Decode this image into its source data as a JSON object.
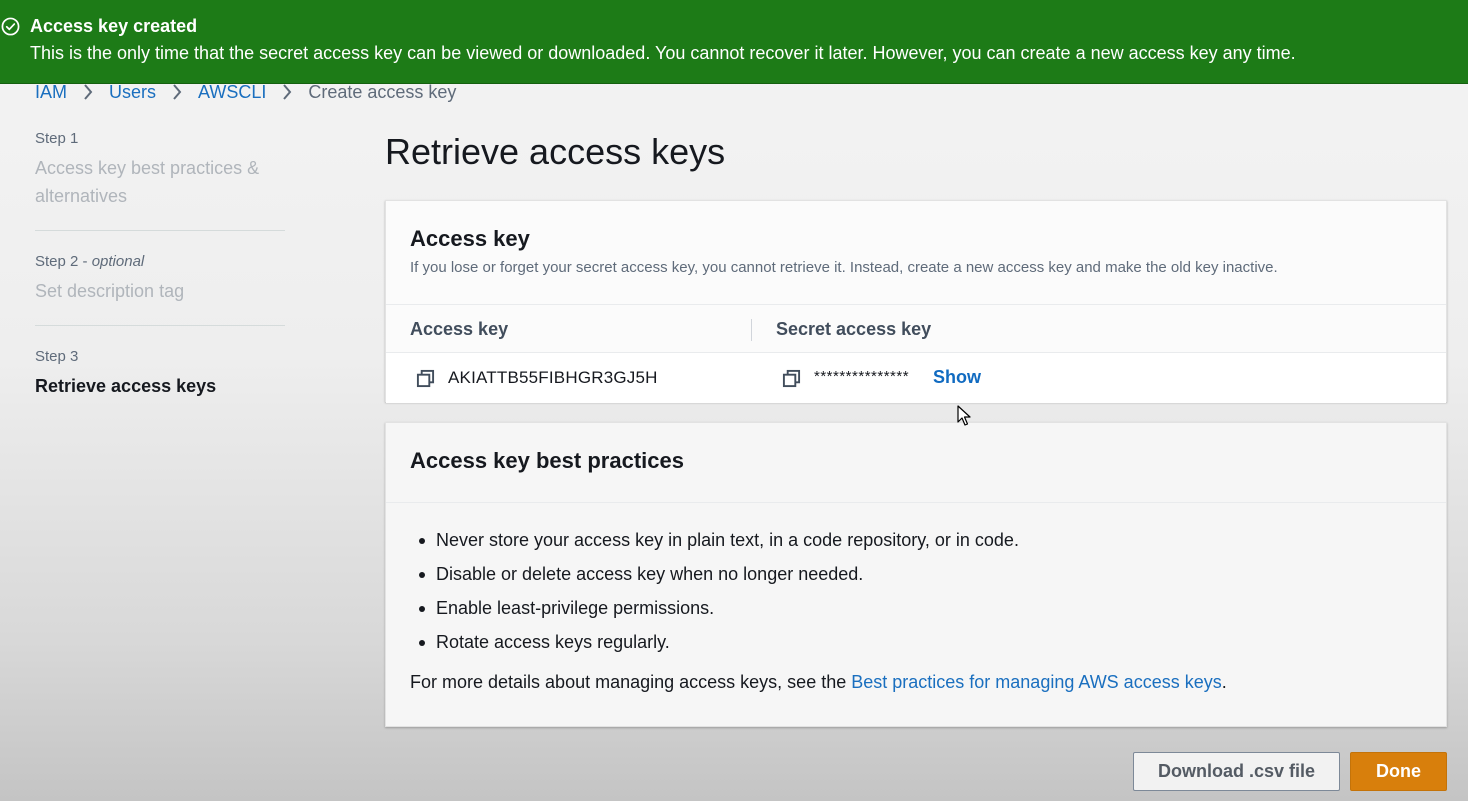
{
  "flash": {
    "icon": "check-circle-icon",
    "title": "Access key created",
    "message": "This is the only time that the secret access key can be viewed or downloaded. You cannot recover it later. However, you can create a new access key any time.",
    "color": "#1d7b17"
  },
  "breadcrumb": {
    "items": [
      "IAM",
      "Users",
      "AWSCLI",
      "Create access key"
    ]
  },
  "steps": [
    {
      "number": "Step 1",
      "optional": "",
      "title": "Access key best practices & alternatives"
    },
    {
      "number": "Step 2 - ",
      "optional": "optional",
      "title": "Set description tag"
    },
    {
      "number": "Step 3",
      "optional": "",
      "title": "Retrieve access keys"
    }
  ],
  "page_title": "Retrieve access keys",
  "access_key_card": {
    "title": "Access key",
    "description": "If you lose or forget your secret access key, you cannot retrieve it. Instead, create a new access key and make the old key inactive.",
    "columns": [
      "Access key",
      "Secret access key"
    ],
    "access_key_value": "AKIATTB55FIBHGR3GJ5H",
    "secret_masked": "***************",
    "show_label": "Show"
  },
  "best_practices_card": {
    "title": "Access key best practices",
    "items": [
      "Never store your access key in plain text, in a code repository, or in code.",
      "Disable or delete access key when no longer needed.",
      "Enable least-privilege permissions.",
      "Rotate access keys regularly."
    ],
    "more_prefix": "For more details about managing access keys, see the ",
    "more_link": "Best practices for managing AWS access keys",
    "more_suffix": "."
  },
  "buttons": {
    "download": "Download .csv file",
    "done": "Done"
  },
  "colors": {
    "link": "#116bc1",
    "primary_button": "#d87f0c"
  }
}
